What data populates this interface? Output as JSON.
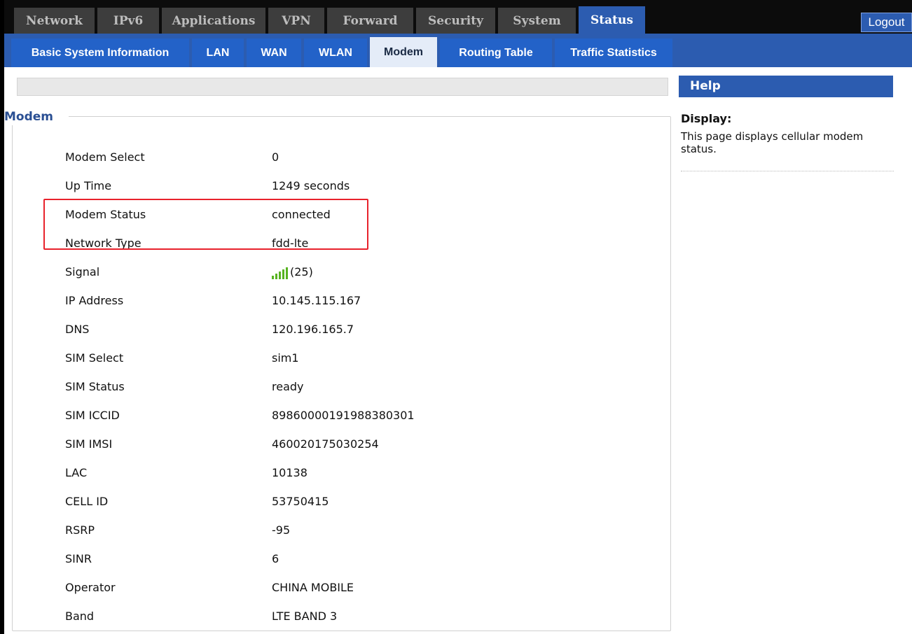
{
  "topnav": {
    "tabs": [
      {
        "label": "Network"
      },
      {
        "label": "IPv6"
      },
      {
        "label": "Applications"
      },
      {
        "label": "VPN"
      },
      {
        "label": "Forward"
      },
      {
        "label": "Security"
      },
      {
        "label": "System"
      },
      {
        "label": "Status"
      }
    ],
    "active": "Status",
    "logout_label": "Logout"
  },
  "subnav": {
    "tabs": [
      {
        "label": "Basic System Information"
      },
      {
        "label": "LAN"
      },
      {
        "label": "WAN"
      },
      {
        "label": "WLAN"
      },
      {
        "label": "Modem"
      },
      {
        "label": "Routing Table"
      },
      {
        "label": "Traffic Statistics"
      }
    ],
    "active": "Modem"
  },
  "section": {
    "title": "Modem",
    "rows": [
      {
        "label": "Modem Select",
        "value": "0"
      },
      {
        "label": "Up Time",
        "value": "1249 seconds"
      },
      {
        "label": "Modem Status",
        "value": "connected"
      },
      {
        "label": "Network Type",
        "value": "fdd-lte"
      },
      {
        "label": "Signal",
        "value": "(25)",
        "icon": "signal-strength-icon",
        "signal_bars": 5
      },
      {
        "label": "IP Address",
        "value": "10.145.115.167"
      },
      {
        "label": "DNS",
        "value": "120.196.165.7"
      },
      {
        "label": "SIM Select",
        "value": "sim1"
      },
      {
        "label": "SIM Status",
        "value": "ready"
      },
      {
        "label": "SIM ICCID",
        "value": "89860000191988380301"
      },
      {
        "label": "SIM IMSI",
        "value": "460020175030254"
      },
      {
        "label": "LAC",
        "value": "10138"
      },
      {
        "label": "CELL ID",
        "value": "53750415"
      },
      {
        "label": "RSRP",
        "value": "-95"
      },
      {
        "label": "SINR",
        "value": "6"
      },
      {
        "label": "Operator",
        "value": "CHINA MOBILE"
      },
      {
        "label": "Band",
        "value": "LTE BAND 3"
      }
    ]
  },
  "help": {
    "header": "Help",
    "title": "Display:",
    "text": "This page displays cellular modem status."
  },
  "colors": {
    "topnav_bg": "#0c0c0c",
    "tab_inactive": "#3d3d3d",
    "accent_blue": "#2c5cb0",
    "highlight_red": "#e8222c",
    "signal_green": "#58b321"
  }
}
